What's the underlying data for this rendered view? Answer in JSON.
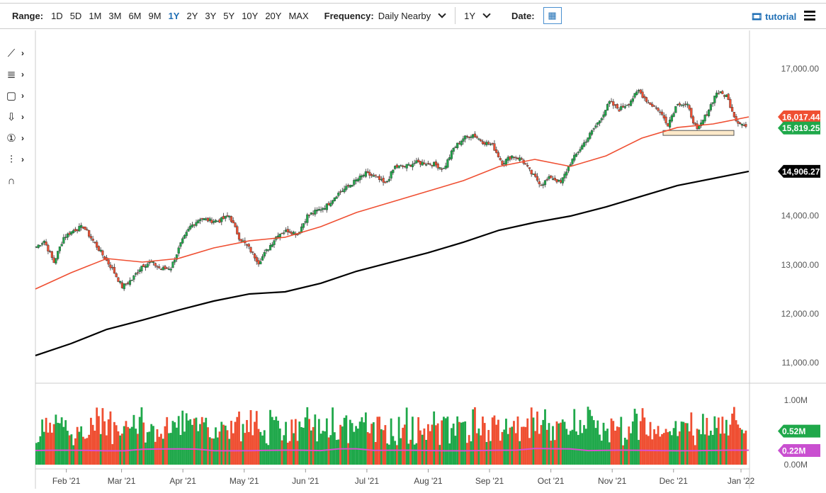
{
  "toolbar": {
    "range_label": "Range:",
    "ranges": [
      "1D",
      "5D",
      "1M",
      "3M",
      "6M",
      "9M",
      "1Y",
      "2Y",
      "3Y",
      "5Y",
      "10Y",
      "20Y",
      "MAX"
    ],
    "active_range": "1Y",
    "frequency_label": "Frequency:",
    "frequency_value": "Daily Nearby",
    "period_value": "1Y",
    "date_label": "Date:",
    "tutorial_label": "tutorial"
  },
  "tools": [
    "line-tool-icon",
    "fib-tool-icon",
    "rectangle-tool-icon",
    "arrow-tool-icon",
    "counter-tool-icon",
    "measure-tool-icon",
    "magnet-icon"
  ],
  "tool_glyphs": [
    "⟋",
    "≣",
    "▢",
    "⇩",
    "①",
    "⫶",
    "∩"
  ],
  "colors": {
    "up": "#1fa84a",
    "down": "#ef4f32",
    "ma50": "#ef4f32",
    "ma200": "#000000",
    "avgvol": "#d94fd0"
  },
  "chart_data": {
    "type": "candlestick",
    "price_axis": {
      "min": 11000,
      "max": 17000,
      "ticks": [
        "17,000.00",
        "14,000.00",
        "13,000.00",
        "12,000.00",
        "11,000.00"
      ],
      "tick_values": [
        17000,
        14000,
        13000,
        12000,
        11000
      ]
    },
    "x_ticks": [
      "Feb '21",
      "Mar '21",
      "Apr '21",
      "May '21",
      "Jun '21",
      "Jul '21",
      "Aug '21",
      "Sep '21",
      "Oct '21",
      "Nov '21",
      "Dec '21",
      "Jan '22"
    ],
    "x_tick_positions_month_index": [
      0.1,
      1,
      2,
      3,
      4,
      5,
      6,
      7,
      8,
      9,
      10,
      11.1
    ],
    "weekly_closes": [
      13340,
      13490,
      13050,
      13560,
      13700,
      13780,
      13490,
      13200,
      12910,
      12550,
      12700,
      12980,
      13050,
      12910,
      12940,
      13420,
      13780,
      13950,
      13900,
      13900,
      14000,
      13560,
      13340,
      13050,
      13340,
      13630,
      13700,
      13630,
      14000,
      14100,
      14210,
      14430,
      14570,
      14720,
      14860,
      14790,
      14640,
      15000,
      15000,
      15080,
      15080,
      15050,
      14960,
      15370,
      15580,
      15660,
      15510,
      15440,
      15080,
      15220,
      15150,
      14860,
      14640,
      14790,
      14670,
      15080,
      15370,
      15660,
      15950,
      16310,
      16170,
      16310,
      16550,
      16310,
      16170,
      15870,
      16310,
      16240,
      15730,
      16090,
      16520,
      16450,
      15950,
      15819
    ],
    "ma50": [
      12506,
      12838,
      13127,
      13055,
      13127,
      13344,
      13489,
      13561,
      13778,
      14067,
      14283,
      14500,
      14717,
      15006,
      15150,
      15006,
      15223,
      15584,
      15801,
      15873,
      16017
    ],
    "ma200": [
      11148,
      11393,
      11682,
      11870,
      12073,
      12260,
      12405,
      12448,
      12622,
      12867,
      13055,
      13243,
      13460,
      13705,
      13864,
      13994,
      14182,
      14399,
      14616,
      14760,
      14906
    ],
    "last_labels": {
      "ma50": "16,017.44",
      "close": "15,819.25",
      "ma200": "14,906.27"
    },
    "volume_axis": {
      "ticks": [
        "1.00M",
        "0.00M"
      ],
      "max": 1.1
    },
    "volume_last": "0.52M",
    "avg_volume_last": "0.22M",
    "volume_last_value": 0.52,
    "avg_volume_value": 0.22,
    "support_zone": [
      15640,
      15740
    ]
  }
}
